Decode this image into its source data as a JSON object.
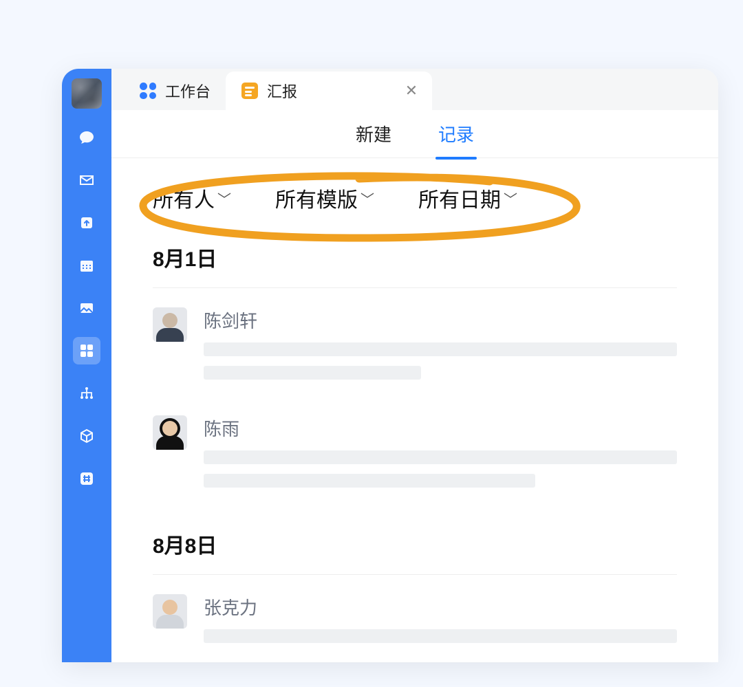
{
  "tabs": {
    "workspace": "工作台",
    "report": "汇报"
  },
  "subtabs": {
    "new": "新建",
    "records": "记录"
  },
  "filters": {
    "people": "所有人",
    "templates": "所有模版",
    "dates": "所有日期"
  },
  "sections": [
    {
      "date": "8月1日",
      "items": [
        {
          "name": "陈剑轩"
        },
        {
          "name": "陈雨"
        }
      ]
    },
    {
      "date": "8月8日",
      "items": [
        {
          "name": "张克力"
        }
      ]
    }
  ]
}
